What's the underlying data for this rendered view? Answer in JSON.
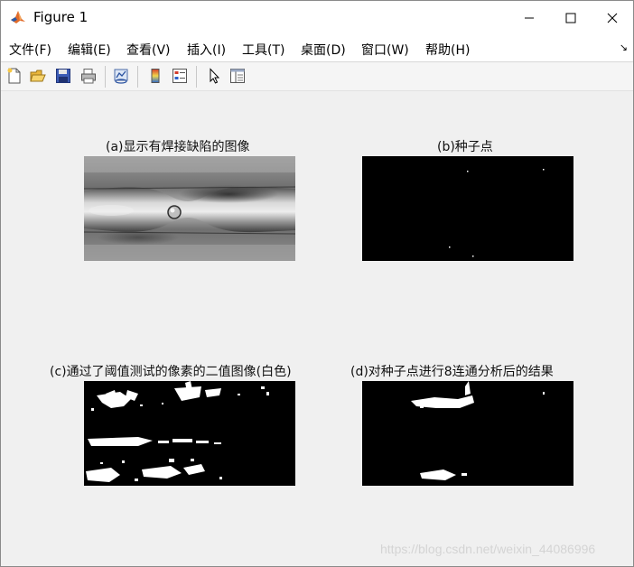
{
  "window": {
    "title": "Figure 1",
    "controls": {
      "minimize": "minimize-icon",
      "maximize": "maximize-icon",
      "close": "close-icon"
    }
  },
  "menu": {
    "file": "文件(F)",
    "edit": "编辑(E)",
    "view": "查看(V)",
    "insert": "插入(I)",
    "tools": "工具(T)",
    "desktop": "桌面(D)",
    "window": "窗口(W)",
    "help": "帮助(H)",
    "dock_arrow": "↘"
  },
  "toolbar": {
    "icons": [
      "new-figure-icon",
      "open-file-icon",
      "save-icon",
      "print-icon",
      "link-plot-icon",
      "insert-colorbar-icon",
      "insert-legend-icon",
      "edit-plot-icon",
      "open-property-inspector-icon"
    ]
  },
  "subplots": {
    "a": {
      "title": "(a)显示有焊接缺陷的图像",
      "image": "grayscale-weld-image"
    },
    "b": {
      "title": "(b)种子点",
      "image": "binary-seed-points"
    },
    "c": {
      "title": "(c)通过了阈值测试的像素的二值图像(白色)",
      "image": "binary-threshold-image"
    },
    "d": {
      "title": "(d)对种子点进行8连通分析后的结果",
      "image": "binary-connected-result"
    }
  },
  "watermark": "https://blog.csdn.net/weixin_44086996",
  "colors": {
    "window_bg": "#f0f0f0",
    "axes_bg": "#000000",
    "titlebar_bg": "#ffffff"
  }
}
